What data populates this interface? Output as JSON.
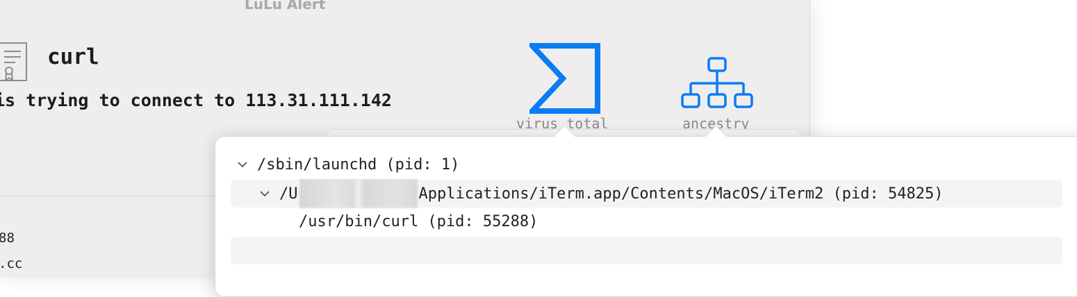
{
  "window": {
    "title": "LuLu Alert"
  },
  "alert": {
    "process_name": "curl",
    "message": "is trying to connect to 113.31.111.142",
    "detail_lines": [
      "88",
      ".cc"
    ]
  },
  "buttons": {
    "virustotal_label": "virus total",
    "ancestry_label": "ancestry"
  },
  "ancestry_tree": {
    "rows": [
      {
        "text": "/sbin/launchd (pid: 1)",
        "expanded": true
      },
      {
        "prefix": "/U",
        "text": "Applications/iTerm.app/Contents/MacOS/iTerm2 (pid: 54825)",
        "expanded": true,
        "redacted": true
      },
      {
        "text": "/usr/bin/curl (pid: 55288)",
        "expanded": false
      }
    ]
  },
  "colors": {
    "accent": "#0a7cf5",
    "window_bg": "#efedee"
  },
  "icons": [
    "certificate-icon",
    "virustotal-sigma-icon",
    "ancestry-tree-icon",
    "chevron-down-icon"
  ]
}
